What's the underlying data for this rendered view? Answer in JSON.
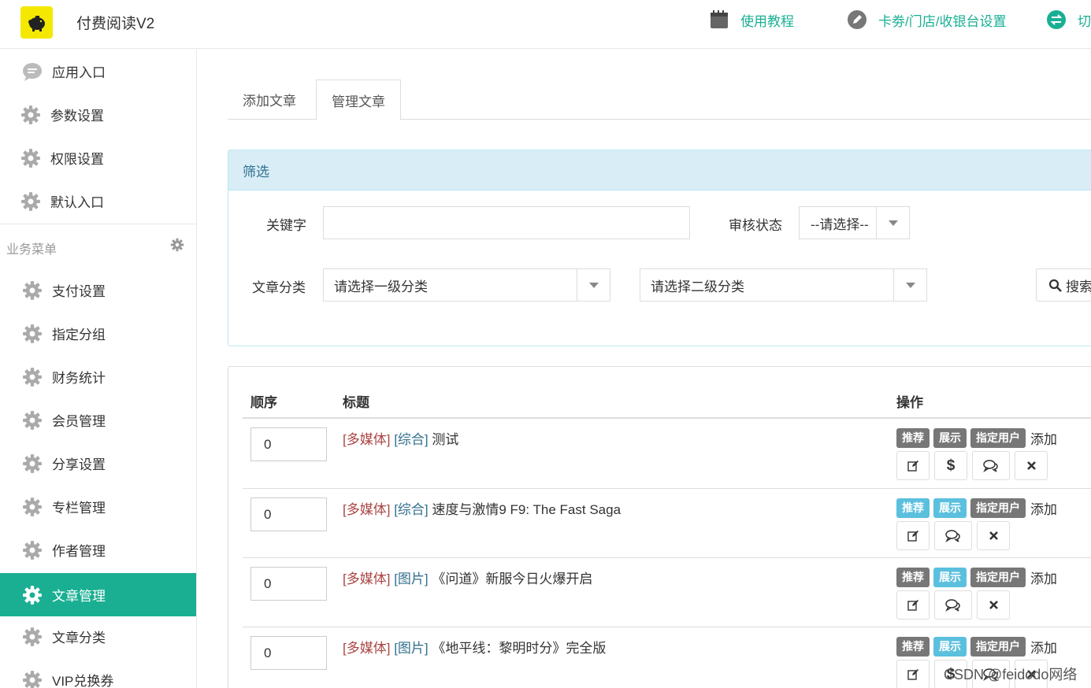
{
  "header": {
    "app_title": "付费阅读V2",
    "nav": [
      {
        "label": "使用教程",
        "icon": "notebook-icon"
      },
      {
        "label": "卡劵/门店/收银台设置",
        "icon": "pencil-icon"
      },
      {
        "label": "切",
        "icon": "switch-icon"
      }
    ]
  },
  "sidebar": {
    "top_items": [
      {
        "label": "应用入口",
        "icon": "chat-bubble-icon"
      },
      {
        "label": "参数设置",
        "icon": "gear-icon"
      },
      {
        "label": "权限设置",
        "icon": "gear-icon"
      },
      {
        "label": "默认入口",
        "icon": "gear-icon"
      }
    ],
    "section_title": "业务菜单",
    "items": [
      {
        "label": "支付设置",
        "icon": "gear-icon"
      },
      {
        "label": "指定分组",
        "icon": "gear-icon"
      },
      {
        "label": "财务统计",
        "icon": "gear-icon"
      },
      {
        "label": "会员管理",
        "icon": "gear-icon"
      },
      {
        "label": "分享设置",
        "icon": "gear-icon"
      },
      {
        "label": "专栏管理",
        "icon": "gear-icon"
      },
      {
        "label": "作者管理",
        "icon": "gear-icon"
      },
      {
        "label": "文章管理",
        "icon": "gear-icon",
        "active": true
      },
      {
        "label": "文章分类",
        "icon": "gear-icon"
      },
      {
        "label": "VIP兑换券",
        "icon": "gear-icon"
      }
    ]
  },
  "tabs": [
    {
      "label": "添加文章",
      "active": false
    },
    {
      "label": "管理文章",
      "active": true
    }
  ],
  "filter": {
    "title": "筛选",
    "keyword_label": "关键字",
    "keyword_value": "",
    "status_label": "审核状态",
    "status_value": "--请选择--",
    "category_label": "文章分类",
    "category1_value": "请选择一级分类",
    "category2_value": "请选择二级分类",
    "search_label": "搜索"
  },
  "table": {
    "headers": {
      "order": "顺序",
      "title": "标题",
      "ops": "操作"
    },
    "rows": [
      {
        "order": "0",
        "tag1": "[多媒体]",
        "tag2": "[综合]",
        "title": "测试",
        "recommend": "推荐",
        "recommend_active": false,
        "show": "展示",
        "show_active": false,
        "assign": "指定用户",
        "add": "添加",
        "has_pay": true
      },
      {
        "order": "0",
        "tag1": "[多媒体]",
        "tag2": "[综合]",
        "title": "速度与激情9 F9: The Fast Saga",
        "recommend": "推荐",
        "recommend_active": true,
        "show": "展示",
        "show_active": true,
        "assign": "指定用户",
        "add": "添加",
        "has_pay": false
      },
      {
        "order": "0",
        "tag1": "[多媒体]",
        "tag2": "[图片]",
        "title": "《问道》新服今日火爆开启",
        "recommend": "推荐",
        "recommend_active": false,
        "show": "展示",
        "show_active": true,
        "assign": "指定用户",
        "add": "添加",
        "has_pay": false
      },
      {
        "order": "0",
        "tag1": "[多媒体]",
        "tag2": "[图片]",
        "title": "《地平线：黎明时分》完全版",
        "recommend": "推荐",
        "recommend_active": false,
        "show": "展示",
        "show_active": true,
        "assign": "指定用户",
        "add": "添加",
        "has_pay": true
      }
    ]
  },
  "watermark": "CSDN @feidodo网络",
  "colors": {
    "accent": "#1aaf93",
    "panel_head": "#d9edf7",
    "badge_default": "#777777",
    "badge_info": "#5bc0de",
    "tag_red": "#a94442",
    "tag_blue": "#31708f"
  }
}
